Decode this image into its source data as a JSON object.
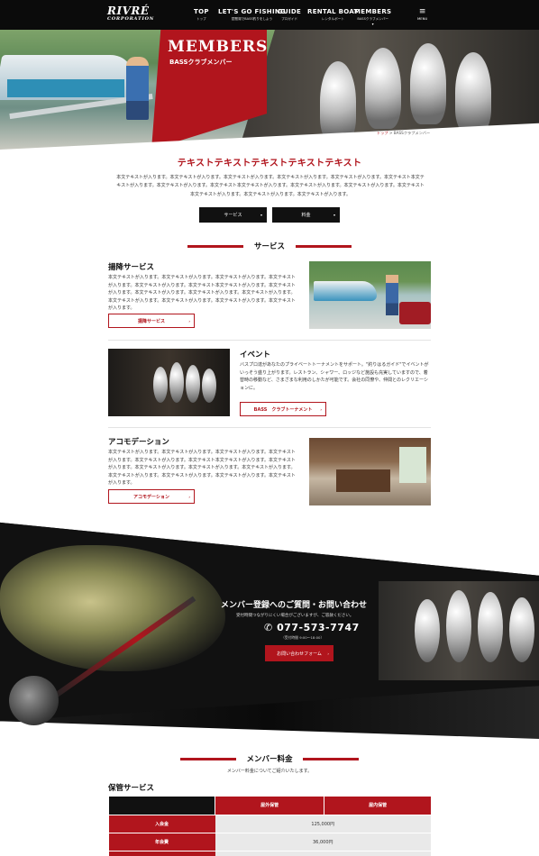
{
  "brand": {
    "logo_main": "RIVRÉ",
    "logo_sub": "CORPORATION"
  },
  "nav": [
    {
      "en": "TOP",
      "ja": "トップ",
      "active": false
    },
    {
      "en": "LET'S GO FISHING",
      "ja": "琵琶湖でBASS釣りをしよう",
      "active": false
    },
    {
      "en": "GUIDE",
      "ja": "プロガイド",
      "active": false
    },
    {
      "en": "RENTAL BOAT",
      "ja": "レンタルボート",
      "active": false
    },
    {
      "en": "MEMBERS",
      "ja": "BASSクラブメンバー",
      "active": true
    }
  ],
  "menu": {
    "label": "MENU",
    "icon": "hamburger-icon"
  },
  "hero": {
    "title": "MEMBERS",
    "subtitle": "BASSクラブメンバー"
  },
  "breadcrumb": {
    "home": "トップ",
    "separator": ">",
    "current": "BASSクラブメンバー"
  },
  "intro": {
    "title": "テキストテキストテキストテキストテキスト",
    "body": "本文テキストが入ります。本文テキストが入ります。本文テキストが入ります。本文テキストが入ります。本文テキストが入ります。本文テキスト本文テキストが入ります。本文テキストが入ります。本文テキスト本文テキストが入ります。本文テキストが入ります。本文テキストが入ります。本文テキスト本文テキストが入ります。本文テキストが入ります。本文テキストが入ります。",
    "buttons": [
      "サービス",
      "料金"
    ]
  },
  "services": {
    "heading": "サービス",
    "items": [
      {
        "title": "揚降サービス",
        "text": "本文テキストが入ります。本文テキストが入ります。本文テキストが入ります。本文テキストが入ります。本文テキストが入ります。本文テキスト本文テキストが入ります。本文テキストが入ります。本文テキストが入ります。本文テキストが入ります。本文テキストが入ります。本文テキストが入ります。本文テキストが入ります。本文テキストが入ります。本文テキストが入ります。",
        "button": "揚降サービス"
      },
      {
        "title": "イベント",
        "text": "バスプロ達があなたのプライベートトーナメントをサポート。\"釣りはるガイド\"でイベントがいっそう盛り上がります。レストラン、シャワー、ロッジなど施設も充実していますので、着替時の移動など、さまざまな利用のしかたが可能です。会社の同僚や、仲間とのレクリエーションに。",
        "button": "BASS　クラブトーナメント"
      },
      {
        "title": "アコモデーション",
        "text": "本文テキストが入ります。本文テキストが入ります。本文テキストが入ります。本文テキストが入ります。本文テキストが入ります。本文テキスト本文テキストが入ります。本文テキストが入ります。本文テキストが入ります。本文テキストが入ります。本文テキストが入ります。本文テキストが入ります。本文テキストが入ります。本文テキストが入ります。本文テキストが入ります。",
        "button": "アコモデーション"
      }
    ]
  },
  "contact": {
    "title": "メンバー登録へのご質問・お問い合わせ",
    "subtitle": "受付時間つながりにくい場合がございますが、ご容赦ください。",
    "phone": "077-573-7747",
    "hours": "（受付時間 9:00〜18:00）",
    "button": "お問い合わせフォーム"
  },
  "fees": {
    "heading": "メンバー料金",
    "subtitle": "メンバー料金についてご紹介いたします。",
    "section": "保管サービス",
    "columns": [
      "屋外保管",
      "屋内保管"
    ],
    "rows": [
      {
        "label": "入会金",
        "value": "125,000円"
      },
      {
        "label": "年会費",
        "value": "36,000円"
      },
      {
        "label": "",
        "value": ""
      }
    ]
  },
  "colors": {
    "accent": "#b1151d",
    "header": "#0b0b0b"
  }
}
